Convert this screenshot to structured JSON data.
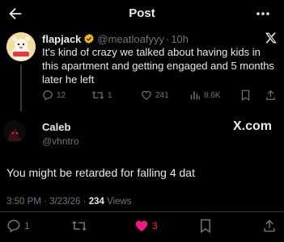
{
  "header": {
    "title": "Post"
  },
  "parent_tweet": {
    "display_name": "flapjack",
    "handle": "@meatloafyyy",
    "separator": "·",
    "time": "10h",
    "text": "It's kind of crazy we talked about having kids in this apartment and getting engaged and 5 months later he left",
    "replies": "12",
    "reposts": "1",
    "likes": "241",
    "views": "8.6K"
  },
  "main_tweet": {
    "display_name": "Caleb",
    "handle": "@vhntro",
    "watermark": "X.com",
    "text": "You might be retarded for falling 4 dat",
    "time": "3:50 PM",
    "date": "3/23/26",
    "views_count": "234",
    "views_label": "Views",
    "dot": "·",
    "replies": "1",
    "likes": "3"
  },
  "colors": {
    "background": "#000000",
    "text": "#e7e9ea",
    "muted": "#71767b",
    "verified": "#f4bb00",
    "like_active": "#f91880",
    "divider": "#2f3336"
  }
}
